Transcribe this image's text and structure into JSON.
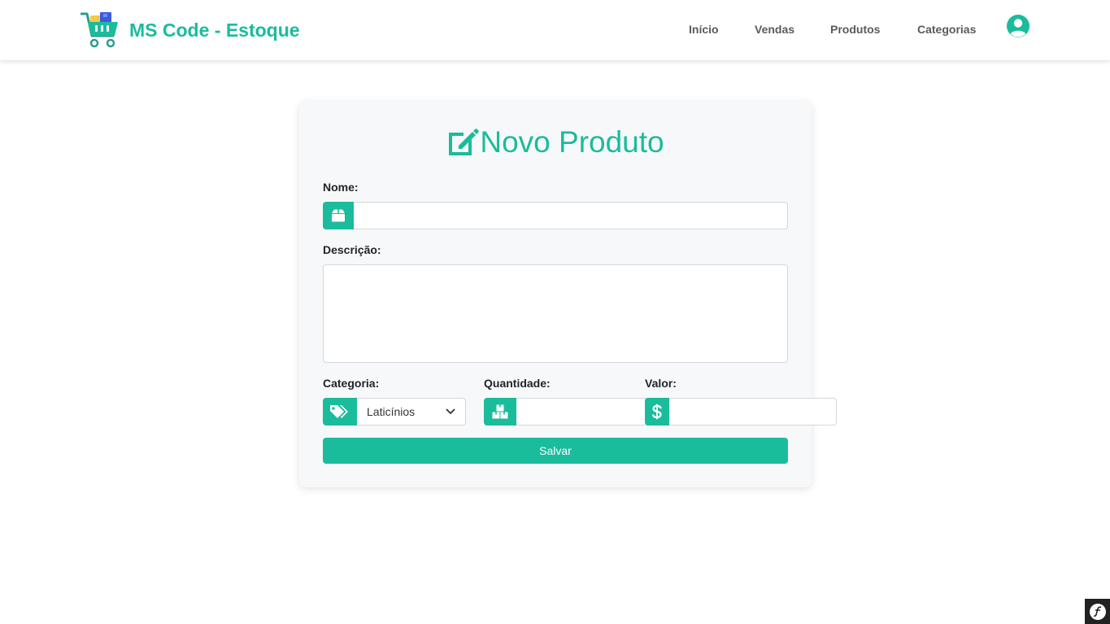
{
  "navbar": {
    "brand_text": "MS Code - Estoque",
    "links": [
      "Início",
      "Vendas",
      "Produtos",
      "Categorias"
    ],
    "user_icon": "user-circle-icon"
  },
  "form": {
    "title": "Novo Produto",
    "title_icon": "edit-icon",
    "nome_label": "Nome:",
    "nome_icon": "box-icon",
    "nome_value": "",
    "descricao_label": "Descrição:",
    "descricao_value": "",
    "categoria_label": "Categoria:",
    "categoria_icon": "tags-icon",
    "categoria_selected": "Laticínios",
    "quantidade_label": "Quantidade:",
    "quantidade_icon": "boxes-icon",
    "quantidade_value": "",
    "valor_label": "Valor:",
    "valor_icon": "dollar-icon",
    "valor_value": "",
    "save_label": "Salvar"
  },
  "colors": {
    "accent": "#1abc9c",
    "nav_text": "#5a5a5a",
    "card_bg": "#f7f8f9"
  },
  "debug_toolbar_icon": "symfony-icon"
}
